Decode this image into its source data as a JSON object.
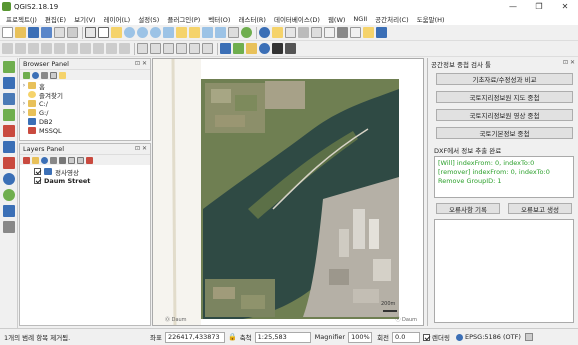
{
  "window": {
    "title": "QGIS2.18.19",
    "minimize_glyph": "—",
    "restore_glyph": "❐",
    "close_glyph": "✕"
  },
  "menu": [
    "프로젝트(J)",
    "편집(E)",
    "보기(V)",
    "레이어(L)",
    "설정(S)",
    "플러그인(P)",
    "벡터(O)",
    "래스터(R)",
    "데이터베이스(D)",
    "웹(W)",
    "NGII",
    "공간처리(C)",
    "도움말(H)"
  ],
  "browser_panel": {
    "title": "Browser Panel",
    "items": [
      {
        "label": "홈",
        "icon": "folder-icon",
        "arrow": "›"
      },
      {
        "label": "즐겨찾기",
        "icon": "star-icon",
        "arrow": ""
      },
      {
        "label": "C:/",
        "icon": "folder-icon",
        "arrow": "›"
      },
      {
        "label": "G:/",
        "icon": "folder-icon",
        "arrow": "›"
      },
      {
        "label": "DB2",
        "icon": "database-icon",
        "arrow": ""
      },
      {
        "label": "MSSQL",
        "icon": "database-icon",
        "arrow": ""
      }
    ]
  },
  "layers_panel": {
    "title": "Layers Panel",
    "layers": [
      {
        "label": "정사영상",
        "checked": true
      },
      {
        "label": "Daum Street",
        "checked": true
      }
    ]
  },
  "right_panel": {
    "title": "공간정보 중첩 검사 툴",
    "buttons": [
      "기초자료/수정성과 비교",
      "국토지리정보원 지도 중첩",
      "국토지리정보원 영상 중첩",
      "국토기본정보 중첩"
    ],
    "dxf_label": "DXF에서 정보 추출 완료",
    "log_lines": [
      "[Will] indexFrom: 0, indexTo:0",
      "[remover] indexFrom: 0, indexTo:0",
      "Remove GroupID: 1"
    ],
    "bottom_buttons": [
      "오류사항 기록",
      "오류보고 생성"
    ]
  },
  "map": {
    "watermark_left": "Ⓞ Daum",
    "watermark_right": "ⓒ Daum",
    "scale_bar": "200m"
  },
  "statusbar": {
    "message": "1개의 범례 항목 제거됨.",
    "coord_label": "좌표",
    "coord_value": "226417,433873",
    "scale_label": "축척",
    "scale_value": "1:25,583",
    "magnifier_label": "Magnifier",
    "magnifier_value": "100%",
    "rotation_label": "회전",
    "rotation_value": "0.0",
    "render_label": "렌더링",
    "render_checked": true,
    "crs": "EPSG:5186 (OTF)"
  },
  "colors": {
    "accent_green": "#589632",
    "log_text": "#2ca02c",
    "river": "#2f4a44",
    "vegetation": "#6f7f52",
    "urban": "#b5b0a6"
  }
}
